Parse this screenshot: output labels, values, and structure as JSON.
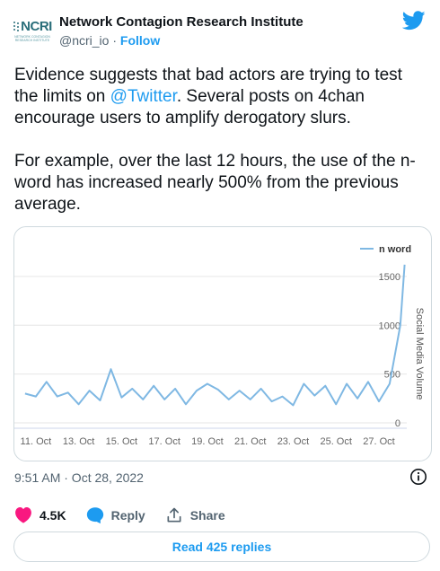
{
  "author": {
    "name": "Network Contagion Research Institute",
    "handle": "@ncri_io",
    "separator": " · ",
    "follow_label": "Follow",
    "logo_text": "NCRI",
    "logo_subtext": "NETWORK CONTAGION RESEARCH INSTITUTE"
  },
  "tweet": {
    "para1_before": "Evidence suggests that bad actors are trying to test the limits on ",
    "mention": "@Twitter",
    "para1_after": ". Several posts on 4chan encourage users to amplify derogatory slurs.",
    "para2": "For example, over the last 12 hours, the use of the n-word has increased nearly 500% from the previous average."
  },
  "timestamp": "9:51 AM · Oct 28, 2022",
  "actions": {
    "likes": "4.5K",
    "reply_label": "Reply",
    "share_label": "Share"
  },
  "read_replies_label": "Read 425 replies",
  "colors": {
    "accent": "#1d9bf0",
    "like": "#f91880",
    "series": "#7fb8e3"
  },
  "icons": {
    "brand": "twitter-bird-icon",
    "info": "info-icon",
    "like": "heart-icon",
    "reply": "speech-bubble-icon",
    "share": "share-arrow-icon"
  },
  "chart_data": {
    "type": "line",
    "title": "",
    "xlabel": "",
    "ylabel": "Social Media Volume",
    "y_axis_side": "right",
    "ylim": [
      0,
      1600
    ],
    "yticks": [
      0,
      500,
      1000,
      1500
    ],
    "xlim": [
      10,
      28.3
    ],
    "xticks": [
      {
        "x": 11,
        "label": "11. Oct"
      },
      {
        "x": 13,
        "label": "13. Oct"
      },
      {
        "x": 15,
        "label": "15. Oct"
      },
      {
        "x": 17,
        "label": "17. Oct"
      },
      {
        "x": 19,
        "label": "19. Oct"
      },
      {
        "x": 21,
        "label": "21. Oct"
      },
      {
        "x": 23,
        "label": "23. Oct"
      },
      {
        "x": 25,
        "label": "25. Oct"
      },
      {
        "x": 27,
        "label": "27. Oct"
      }
    ],
    "grid": true,
    "legend_position": "top-right",
    "series": [
      {
        "name": "n word",
        "x": [
          10.5,
          11.0,
          11.5,
          12.0,
          12.5,
          13.0,
          13.5,
          14.0,
          14.5,
          15.0,
          15.5,
          16.0,
          16.5,
          17.0,
          17.5,
          18.0,
          18.5,
          19.0,
          19.5,
          20.0,
          20.5,
          21.0,
          21.5,
          22.0,
          22.5,
          23.0,
          23.5,
          24.0,
          24.5,
          25.0,
          25.5,
          26.0,
          26.5,
          27.0,
          27.5,
          28.0,
          28.2
        ],
        "values": [
          300,
          270,
          420,
          270,
          310,
          190,
          330,
          230,
          550,
          260,
          350,
          240,
          380,
          240,
          350,
          190,
          330,
          400,
          340,
          240,
          330,
          240,
          350,
          220,
          270,
          180,
          400,
          280,
          380,
          190,
          400,
          250,
          420,
          220,
          400,
          1000,
          1620
        ]
      }
    ]
  }
}
